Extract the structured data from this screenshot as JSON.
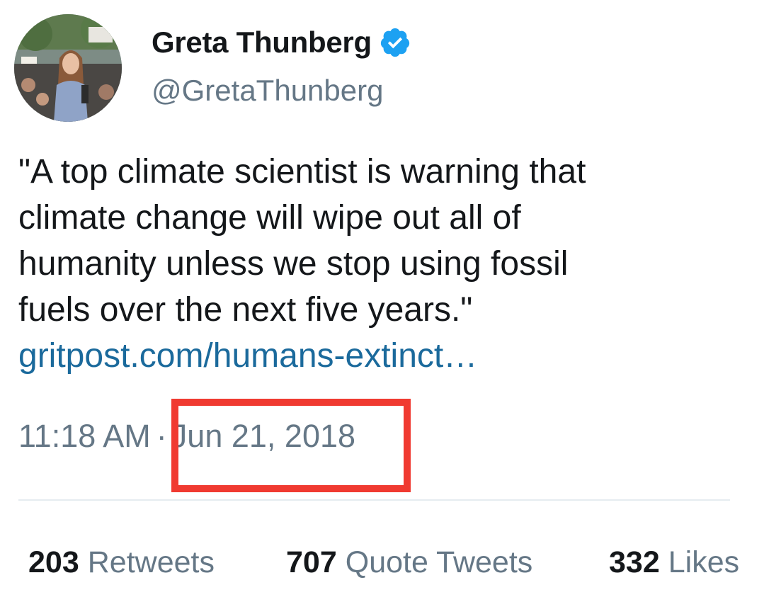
{
  "author": {
    "display_name": "Greta Thunberg",
    "handle": "@GretaThunberg",
    "verified_icon": "verified-badge-icon",
    "verified_color": "#1da1f2"
  },
  "tweet": {
    "text": "\"A top climate scientist is warning that\nclimate change will wipe out all of\nhumanity unless we stop using fossil\nfuels over the next five years.\"",
    "link": "gritpost.com/humans-extinct…",
    "link_color": "#1b6a9c"
  },
  "timestamp": {
    "time": "11:18 AM",
    "separator": "·",
    "date": "Jun 21, 2018"
  },
  "highlight": {
    "color": "#f03a31"
  },
  "stats": {
    "retweets": {
      "count": "203",
      "label": "Retweets"
    },
    "quote_tweets": {
      "count": "707",
      "label": "Quote Tweets"
    },
    "likes": {
      "count": "332",
      "label": "Likes"
    }
  }
}
